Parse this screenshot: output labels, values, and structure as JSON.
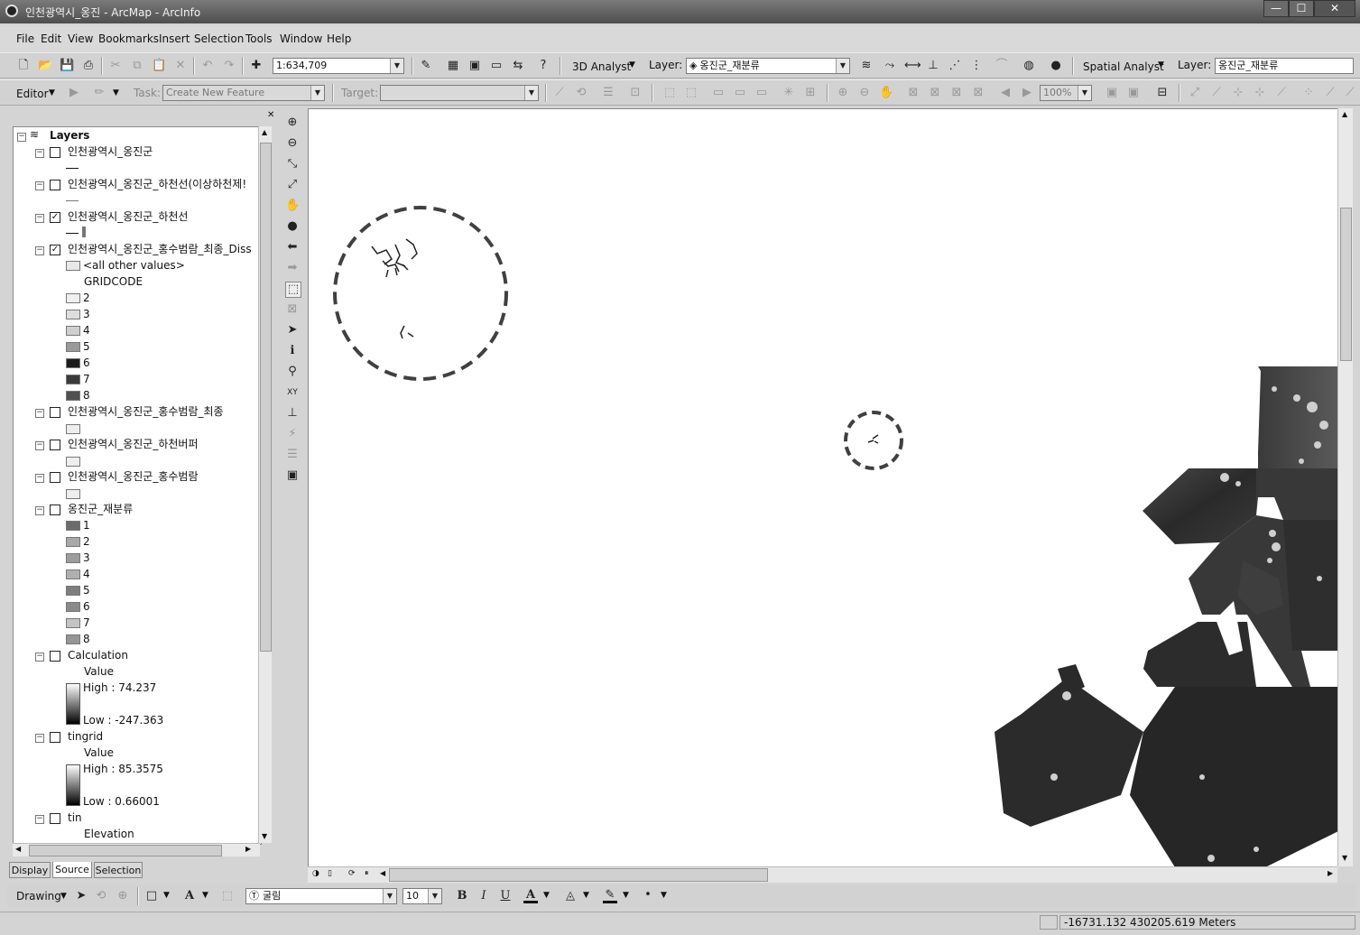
{
  "window": {
    "title": "인천광역시_옹진 - ArcMap - ArcInfo",
    "minimize": "—",
    "maximize": "☐",
    "close": "✕"
  },
  "menu": [
    "File",
    "Edit",
    "View",
    "Bookmarks",
    "Insert",
    "Selection",
    "Tools",
    "Window",
    "Help"
  ],
  "standard_toolbar": {
    "scale": "1:634,709",
    "analyst_3d": "3D Analyst",
    "layer_label": "Layer:",
    "layer_value": "옹진군_재분류",
    "spatial_analyst": "Spatial Analyst",
    "spatial_layer_label": "Layer:",
    "spatial_layer_value": "옹진군_재분류"
  },
  "editor_toolbar": {
    "editor": "Editor",
    "task_label": "Task:",
    "task_value": "Create New Feature",
    "target_label": "Target:",
    "target_value": "",
    "zoom": "100%"
  },
  "toc": {
    "root": "Layers",
    "layers": [
      {
        "name": "인천광역시_옹진군",
        "checked": false
      },
      {
        "name": "인천광역시_옹진군_하천선(이상하천제!",
        "checked": false
      },
      {
        "name": "인천광역시_옹진군_하천선",
        "checked": true
      },
      {
        "name": "인천광역시_옹진군_홍수범람_최종_Diss",
        "checked": true,
        "other": "<all other values>",
        "field": "GRIDCODE",
        "classes": [
          "2",
          "3",
          "4",
          "5",
          "6",
          "7",
          "8"
        ]
      },
      {
        "name": "인천광역시_옹진군_홍수범람_최종",
        "checked": false
      },
      {
        "name": "인천광역시_옹진군_하천버퍼",
        "checked": false
      },
      {
        "name": "인천광역시_옹진군_홍수범람",
        "checked": false
      },
      {
        "name": "옹진군_재분류",
        "checked": false,
        "classes": [
          "1",
          "2",
          "3",
          "4",
          "5",
          "6",
          "7",
          "8"
        ]
      },
      {
        "name": "Calculation",
        "checked": false,
        "value": "Value",
        "high": "High : 74.237",
        "low": "Low : -247.363"
      },
      {
        "name": "tingrid",
        "checked": false,
        "value": "Value",
        "high": "High : 85.3575",
        "low": "Low : 0.66001"
      },
      {
        "name": "tin",
        "checked": false,
        "elevation": "Elevation"
      }
    ],
    "tabs": [
      "Display",
      "Source",
      "Selection"
    ]
  },
  "colors": {
    "diss_classes": [
      "#efefef",
      "#dedede",
      "#cfcfcf",
      "#9a9a9a",
      "#1c1c1c",
      "#3b3b3b",
      "#505050"
    ],
    "reclass": [
      "#6c6c6c",
      "#a8a8a8",
      "#9c9c9c",
      "#b0b0b0",
      "#7e7e7e",
      "#8a8a8a",
      "#c4c4c4",
      "#959595"
    ]
  },
  "drawing_toolbar": {
    "drawing": "Drawing",
    "font": "굴림",
    "size": "10",
    "bold": "B",
    "italic": "I",
    "underline": "U"
  },
  "status": {
    "coords": "-16731.132  430205.619 Meters"
  }
}
